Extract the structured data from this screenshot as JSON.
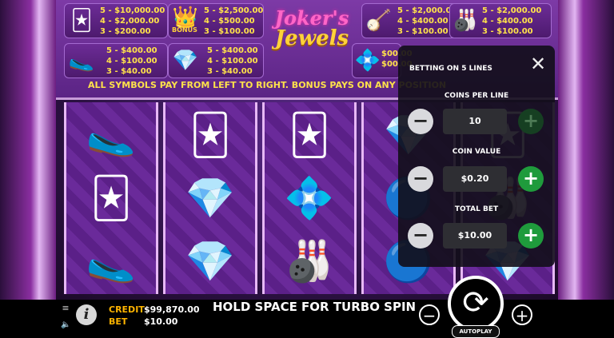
{
  "paytable": {
    "entries": [
      {
        "icon": "🃏",
        "icon_name": "joker-icon",
        "lines": "5 - $10,000.00\n4 - $2,000.00\n3 - $200.00"
      },
      {
        "icon": "👑",
        "icon_name": "crown-bonus-icon",
        "lines": "5 - $2,500.00\n4 - $500.00\n3 - $100.00"
      },
      {
        "icon": "🪕",
        "icon_name": "lute-icon",
        "lines": "5 - $2,000.00\n4 - $400.00\n3 - $100.00"
      },
      {
        "icon": "🎳",
        "icon_name": "juggling-pins-icon",
        "lines": "5 - $2,000.00\n4 - $400.00\n3 - $100.00"
      },
      {
        "icon": "🥿",
        "icon_name": "jester-shoes-icon",
        "lines": "5 - $400.00\n4 - $100.00\n3 - $40.00"
      },
      {
        "icon": "💎",
        "icon_name": "red-diamond-icon",
        "lines": "5 - $400.00\n4 - $100.00\n3 - $40.00"
      },
      {
        "icon": "💠",
        "icon_name": "blue-diamond-icon",
        "lines": "$00.00\n$00.00"
      }
    ],
    "bonus_label": "BONUS",
    "note": "ALL SYMBOLS PAY FROM LEFT TO RIGHT. BONUS PAYS ON ANY POSITION"
  },
  "logo": {
    "line1": "Joker's",
    "line2": "Jewels"
  },
  "reels": [
    {
      "symbols": [
        {
          "icon": "🥿",
          "name": "jester-shoes-icon"
        },
        {
          "icon": "🃏",
          "name": "joker-icon"
        },
        {
          "icon": "🥿",
          "name": "jester-shoes-icon"
        }
      ]
    },
    {
      "symbols": [
        {
          "icon": "🃏",
          "name": "joker-icon"
        },
        {
          "icon": "💎",
          "name": "red-diamond-icon"
        },
        {
          "icon": "💎",
          "name": "red-diamond-icon"
        }
      ]
    },
    {
      "symbols": [
        {
          "icon": "🃏",
          "name": "joker-icon"
        },
        {
          "icon": "💠",
          "name": "blue-diamond-icon"
        },
        {
          "icon": "🎳",
          "name": "juggling-pins-icon"
        }
      ]
    },
    {
      "symbols": [
        {
          "icon": "💎",
          "name": "red-diamond-icon"
        },
        {
          "icon": "🔵",
          "name": "blue-gem-icon"
        },
        {
          "icon": "🔵",
          "name": "blue-gem-icon"
        }
      ]
    },
    {
      "symbols": [
        {
          "icon": "🃏",
          "name": "joker-icon"
        },
        {
          "icon": "🎳",
          "name": "juggling-pins-icon"
        },
        {
          "icon": "💎",
          "name": "red-diamond-icon"
        }
      ]
    }
  ],
  "bet_panel": {
    "title": "BETTING ON 5 LINES",
    "close": "✕",
    "coins_per_line": {
      "label": "COINS PER LINE",
      "value": "10"
    },
    "coin_value": {
      "label": "COIN VALUE",
      "value": "$0.20"
    },
    "total_bet": {
      "label": "TOTAL BET",
      "value": "$10.00"
    },
    "minus": "−",
    "plus": "+"
  },
  "bottom": {
    "credit_label": "CREDIT",
    "credit_value": "$99,870.00",
    "bet_label": "BET",
    "bet_value": "$10.00",
    "message": "HOLD SPACE FOR TURBO SPIN",
    "minus": "−",
    "plus": "+",
    "spin": "⟳",
    "autoplay": "AUTOPLAY",
    "menu_icon": "≡",
    "info_icon": "i",
    "speaker_icon": "🔈"
  },
  "colors": {
    "accent": "#ffb400",
    "plus_green": "#1f9b3c",
    "panel_bg": "#120e1a"
  }
}
